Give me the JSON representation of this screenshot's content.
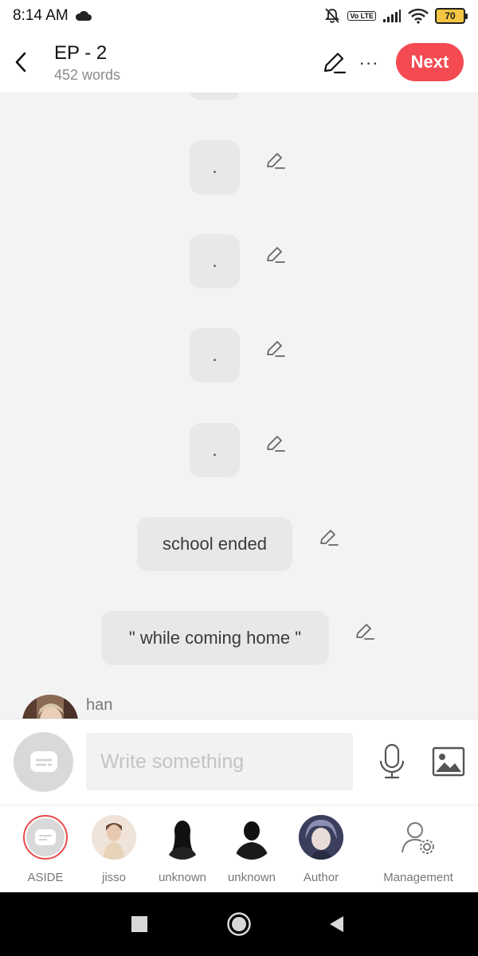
{
  "status": {
    "time": "8:14 AM",
    "battery": "70",
    "lte": "Vo LTE",
    "icons": [
      "cloud-icon",
      "bell-muted-icon",
      "signal-icon",
      "wifi-icon",
      "battery-icon"
    ]
  },
  "header": {
    "title": "EP - 2",
    "subtitle": "452 words",
    "next_label": "Next",
    "more_label": "···",
    "accent_color": "#f44a52"
  },
  "messages": [
    {
      "text": ""
    },
    {
      "text": "."
    },
    {
      "text": "."
    },
    {
      "text": "."
    },
    {
      "text": "."
    },
    {
      "text": "school ended"
    },
    {
      "text": "\" while coming home \""
    }
  ],
  "speaker": {
    "name": "han"
  },
  "input": {
    "placeholder": "Write something"
  },
  "characters": [
    {
      "label": "ASIDE"
    },
    {
      "label": "jisso"
    },
    {
      "label": "unknown"
    },
    {
      "label": "unknown"
    },
    {
      "label": "Author"
    },
    {
      "label": "Management"
    }
  ]
}
